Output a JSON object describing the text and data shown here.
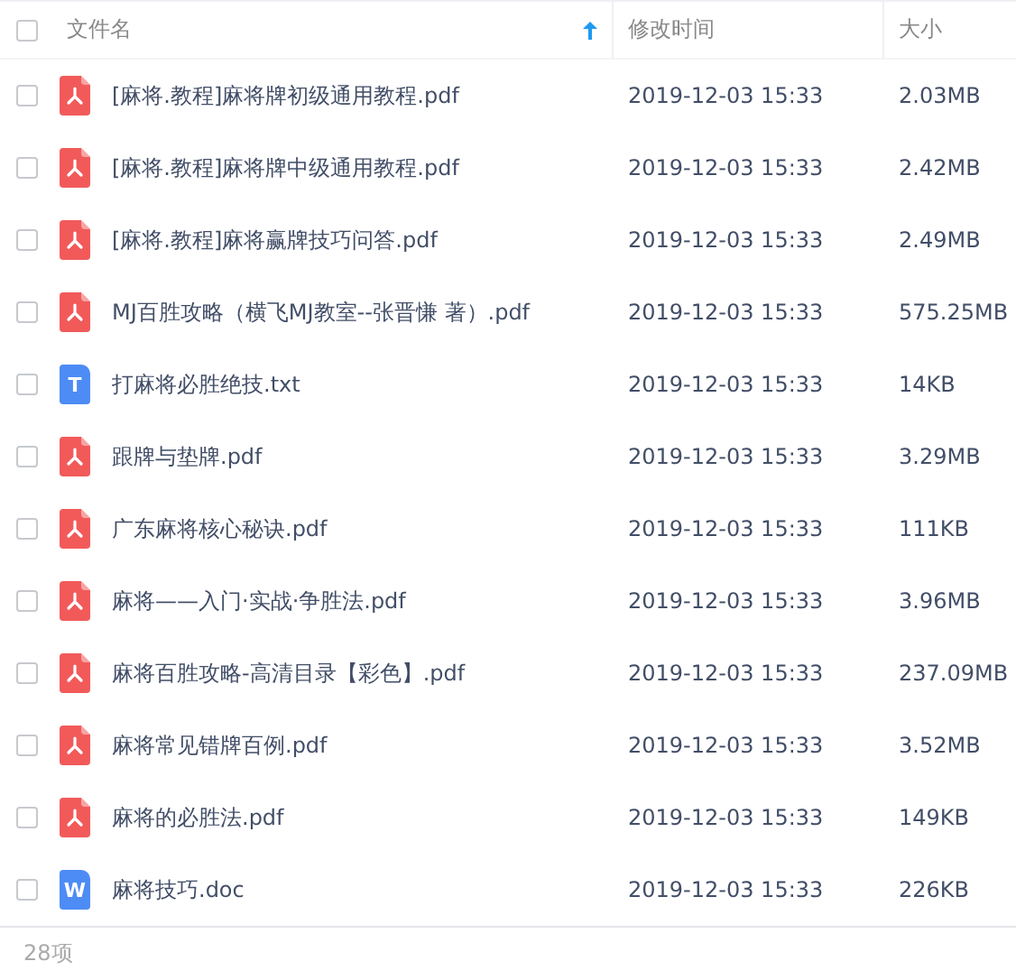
{
  "header": {
    "select_all_checked": false,
    "columns": [
      {
        "label": "文件名",
        "sorted": true
      },
      {
        "label": "修改时间",
        "sorted": false
      },
      {
        "label": "大小",
        "sorted": false
      }
    ]
  },
  "files": [
    {
      "name": "[麻将.教程]麻将牌初级通用教程.pdf",
      "modified": "2019-12-03 15:33",
      "size": "2.03MB",
      "kind": "pdf",
      "checked": false
    },
    {
      "name": "[麻将.教程]麻将牌中级通用教程.pdf",
      "modified": "2019-12-03 15:33",
      "size": "2.42MB",
      "kind": "pdf",
      "checked": false
    },
    {
      "name": "[麻将.教程]麻将赢牌技巧问答.pdf",
      "modified": "2019-12-03 15:33",
      "size": "2.49MB",
      "kind": "pdf",
      "checked": false
    },
    {
      "name": "MJ百胜攻略（横飞MJ教室--张晋慊 著）.pdf",
      "modified": "2019-12-03 15:33",
      "size": "575.25MB",
      "kind": "pdf",
      "checked": false
    },
    {
      "name": "打麻将必胜绝技.txt",
      "modified": "2019-12-03 15:33",
      "size": "14KB",
      "kind": "txt",
      "icon_letter": "T",
      "checked": false
    },
    {
      "name": "跟牌与垫牌.pdf",
      "modified": "2019-12-03 15:33",
      "size": "3.29MB",
      "kind": "pdf",
      "checked": false
    },
    {
      "name": "广东麻将核心秘诀.pdf",
      "modified": "2019-12-03 15:33",
      "size": "111KB",
      "kind": "pdf",
      "checked": false
    },
    {
      "name": "麻将——入门·实战·争胜法.pdf",
      "modified": "2019-12-03 15:33",
      "size": "3.96MB",
      "kind": "pdf",
      "checked": false
    },
    {
      "name": "麻将百胜攻略-高清目录【彩色】.pdf",
      "modified": "2019-12-03 15:33",
      "size": "237.09MB",
      "kind": "pdf",
      "checked": false
    },
    {
      "name": "麻将常见错牌百例.pdf",
      "modified": "2019-12-03 15:33",
      "size": "3.52MB",
      "kind": "pdf",
      "checked": false
    },
    {
      "name": "麻将的必胜法.pdf",
      "modified": "2019-12-03 15:33",
      "size": "149KB",
      "kind": "pdf",
      "checked": false
    },
    {
      "name": "麻将技巧.doc",
      "modified": "2019-12-03 15:33",
      "size": "226KB",
      "kind": "doc",
      "icon_letter": "W",
      "checked": false
    }
  ],
  "footer": {
    "count": "28项"
  }
}
